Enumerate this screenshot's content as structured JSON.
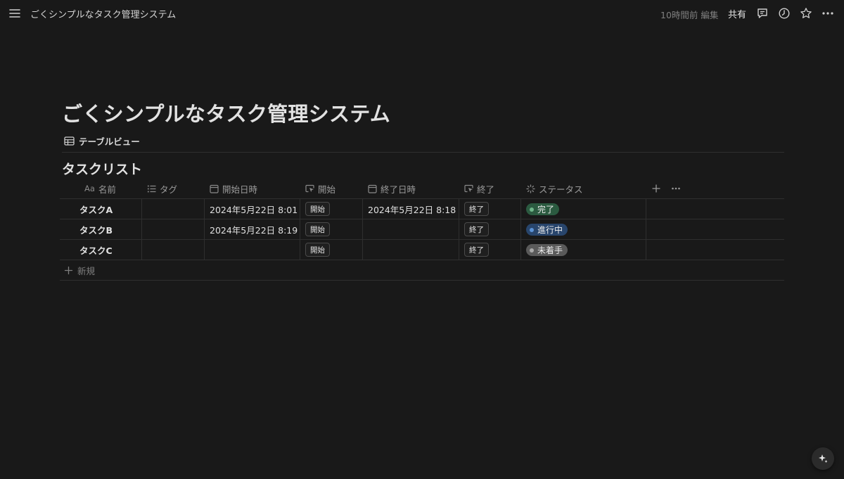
{
  "topbar": {
    "breadcrumb": "ごくシンプルなタスク管理システム",
    "edited": "10時間前 編集",
    "share_label": "共有",
    "icons": [
      "menu-icon",
      "comment-icon",
      "clock-icon",
      "star-icon",
      "more-icon"
    ]
  },
  "page": {
    "title": "ごくシンプルなタスク管理システム",
    "view_tab": "テーブルビュー",
    "database_title": "タスクリスト"
  },
  "table": {
    "columns": [
      {
        "prefix": "Aa",
        "label": "名前",
        "icon": "title-icon"
      },
      {
        "label": "タグ",
        "icon": "list-icon"
      },
      {
        "label": "開始日時",
        "icon": "calendar-icon"
      },
      {
        "label": "開始",
        "icon": "cursor-button-icon"
      },
      {
        "label": "終了日時",
        "icon": "calendar-icon"
      },
      {
        "label": "終了",
        "icon": "cursor-button-icon"
      },
      {
        "label": "ステータス",
        "icon": "status-spinner-icon"
      }
    ],
    "rows": [
      {
        "name": "タスクA",
        "tag": "",
        "start_datetime": "2024年5月22日 8:01",
        "start_button": "開始",
        "end_datetime": "2024年5月22日 8:18",
        "end_button": "終了",
        "status": "完了"
      },
      {
        "name": "タスクB",
        "tag": "",
        "start_datetime": "2024年5月22日 8:19",
        "start_button": "開始",
        "end_datetime": "",
        "end_button": "終了",
        "status": "進行中"
      },
      {
        "name": "タスクC",
        "tag": "",
        "start_datetime": "",
        "start_button": "開始",
        "end_datetime": "",
        "end_button": "終了",
        "status": "未着手"
      }
    ],
    "new_row_label": "新規"
  },
  "status_colors": {
    "完了": {
      "bg": "#2b5a40",
      "dot": "#6fb68a"
    },
    "進行中": {
      "bg": "#28456c",
      "dot": "#5c93d6"
    },
    "未着手": {
      "bg": "#5a5a5a",
      "dot": "#a9a9a9"
    }
  },
  "colors": {
    "background": "#191919",
    "text": "#d4d4d4",
    "muted": "#7f7f7f",
    "border": "#2f2f2f"
  }
}
